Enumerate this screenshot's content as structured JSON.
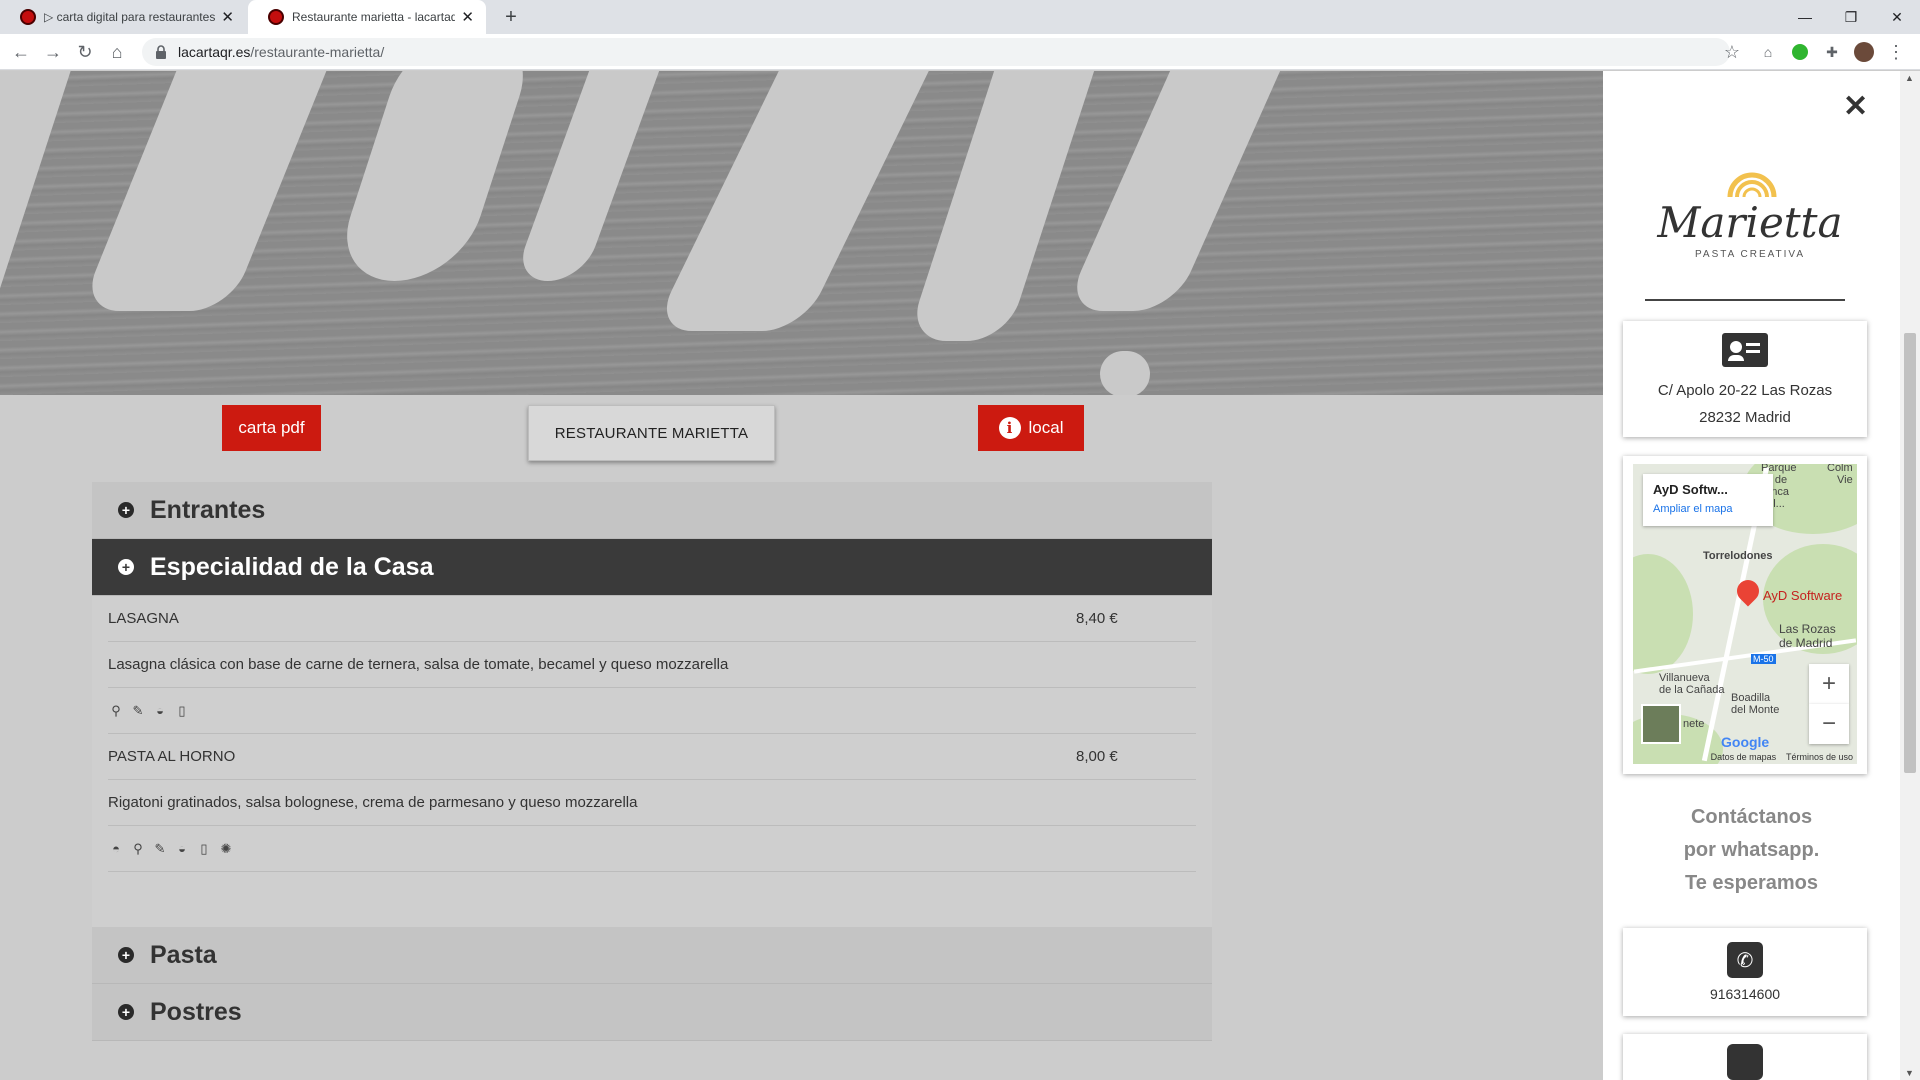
{
  "browser": {
    "tabs": [
      {
        "title": "▷ carta digital para restaurantes",
        "active": false
      },
      {
        "title": "Restaurante marietta - lacartaqr",
        "active": true
      }
    ],
    "url_host": "lacartaqr.es",
    "url_path": "/restaurante-marietta/"
  },
  "page": {
    "pdf_button": "carta pdf",
    "restaurant_name": "RESTAURANTE MARIETTA",
    "local_button": "local",
    "categories": {
      "entrantes": "Entrantes",
      "especialidad": "Especialidad de la Casa",
      "pasta": "Pasta",
      "postres": "Postres"
    },
    "items": [
      {
        "name": "LASAGNA",
        "price": "8,40 €",
        "description": "Lasagna clásica con base de carne de ternera, salsa de tomate, becamel y queso mozzarella"
      },
      {
        "name": "PASTA AL HORNO",
        "price": "8,00 €",
        "description": "Rigatoni gratinados, salsa bolognese, crema de parmesano y queso mozzarella"
      }
    ]
  },
  "sidebar": {
    "logo_title": "Marietta",
    "logo_subtitle": "PASTA CREATIVA",
    "address_line1": "C/ Apolo 20-22 Las Rozas",
    "address_line2": "28232 Madrid",
    "map": {
      "info_title": "AyD Softw...",
      "info_link": "Ampliar el mapa",
      "pin_label": "AyD Software",
      "labels": [
        "Parque",
        "onal de",
        "uenca",
        "del...",
        "Colm",
        "Vie",
        "Torrelodones",
        "Las Rozas",
        "de Madrid",
        "M-50",
        "Villanueva",
        "de la Cañada",
        "Boadilla",
        "del Monte",
        "nete"
      ],
      "google": "Google",
      "footer_data": "Datos de mapas",
      "footer_terms": "Términos de uso"
    },
    "contact_line1": "Contáctanos",
    "contact_line2": "por whatsapp.",
    "contact_line3": "Te esperamos",
    "phone": "916314600"
  },
  "colors": {
    "accent_red": "#cc1a10",
    "dark_category": "#3a3a3a"
  }
}
